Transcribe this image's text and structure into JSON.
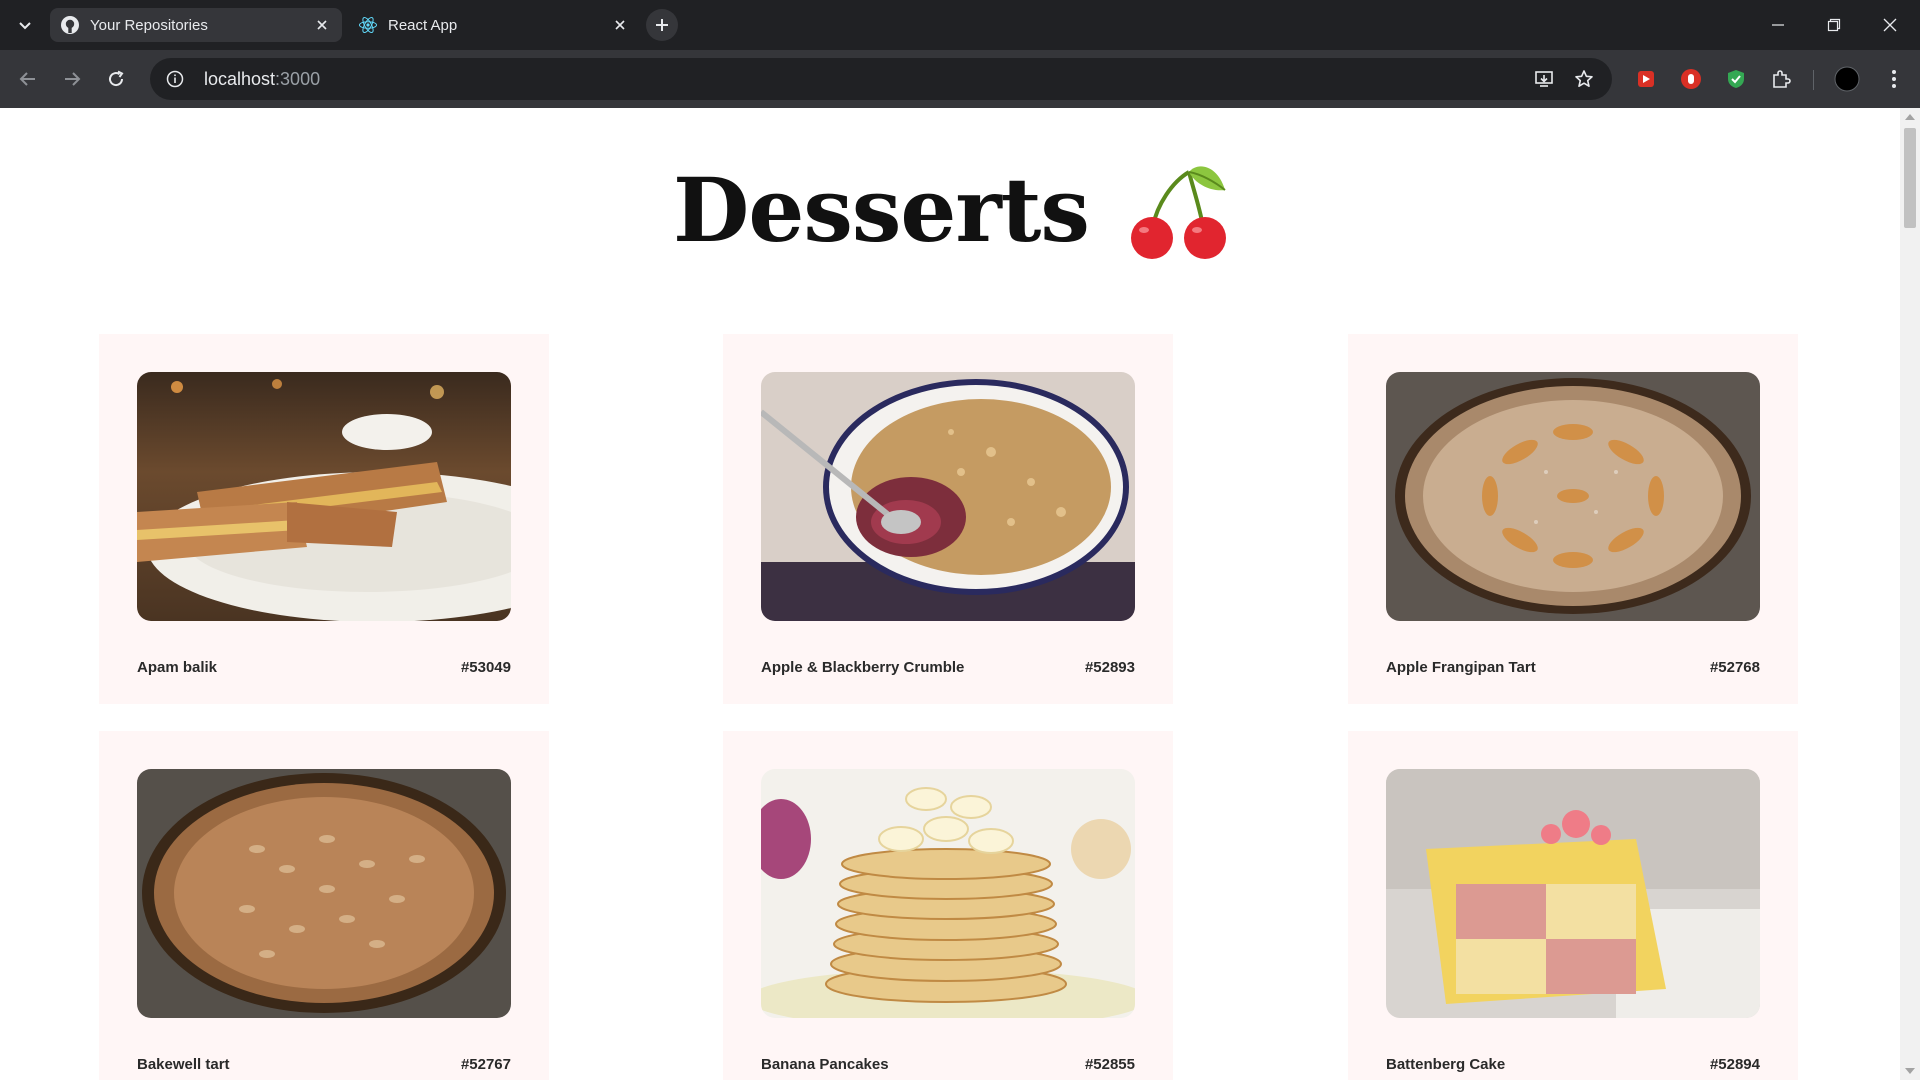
{
  "browser": {
    "tabs": [
      {
        "title": "Your Repositories",
        "favicon": "github-icon",
        "active": true
      },
      {
        "title": "React App",
        "favicon": "react-icon",
        "active": false
      }
    ],
    "address": {
      "host": "localhost",
      "port": ":3000"
    }
  },
  "page": {
    "heading": "Desserts",
    "heading_emoji": "cherries-icon",
    "desserts": [
      {
        "name": "Apam balik",
        "id": "#53049"
      },
      {
        "name": "Apple & Blackberry Crumble",
        "id": "#52893"
      },
      {
        "name": "Apple Frangipan Tart",
        "id": "#52768"
      },
      {
        "name": "Bakewell tart",
        "id": "#52767"
      },
      {
        "name": "Banana Pancakes",
        "id": "#52855"
      },
      {
        "name": "Battenberg Cake",
        "id": "#52894"
      }
    ]
  },
  "colors": {
    "card_background": "#fff6f6",
    "chrome_dark": "#202124",
    "chrome_toolbar": "#35363a"
  }
}
